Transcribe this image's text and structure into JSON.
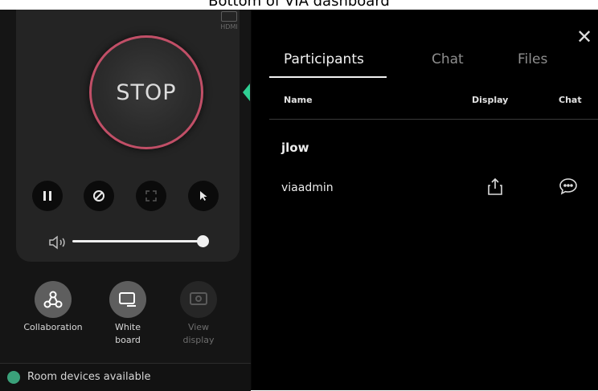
{
  "caption": "Bottom of VIA dashboard",
  "left_panel": {
    "source_label": "HDMI",
    "stop_label": "STOP",
    "controls": [
      {
        "name": "pause-icon"
      },
      {
        "name": "block-icon"
      },
      {
        "name": "fullscreen-icon"
      },
      {
        "name": "pointer-icon"
      }
    ],
    "volume_level": 1.0,
    "tools": [
      {
        "label": "Collaboration",
        "icon": "collaboration-icon",
        "enabled": true
      },
      {
        "label": "White\nboard",
        "icon": "whiteboard-icon",
        "enabled": true
      },
      {
        "label": "View\ndisplay",
        "icon": "view-display-icon",
        "enabled": false
      }
    ],
    "room_devices": "Room devices available"
  },
  "right_panel": {
    "tabs": [
      {
        "label": "Participants",
        "active": true
      },
      {
        "label": "Chat",
        "active": false
      },
      {
        "label": "Files",
        "active": false
      }
    ],
    "columns": {
      "name": "Name",
      "display": "Display",
      "chat": "Chat"
    },
    "participants": [
      {
        "name": "jlow"
      },
      {
        "name": "viaadmin"
      }
    ]
  },
  "colors": {
    "accent_green": "#2fcf93",
    "stop_ring": "#c14f67"
  }
}
